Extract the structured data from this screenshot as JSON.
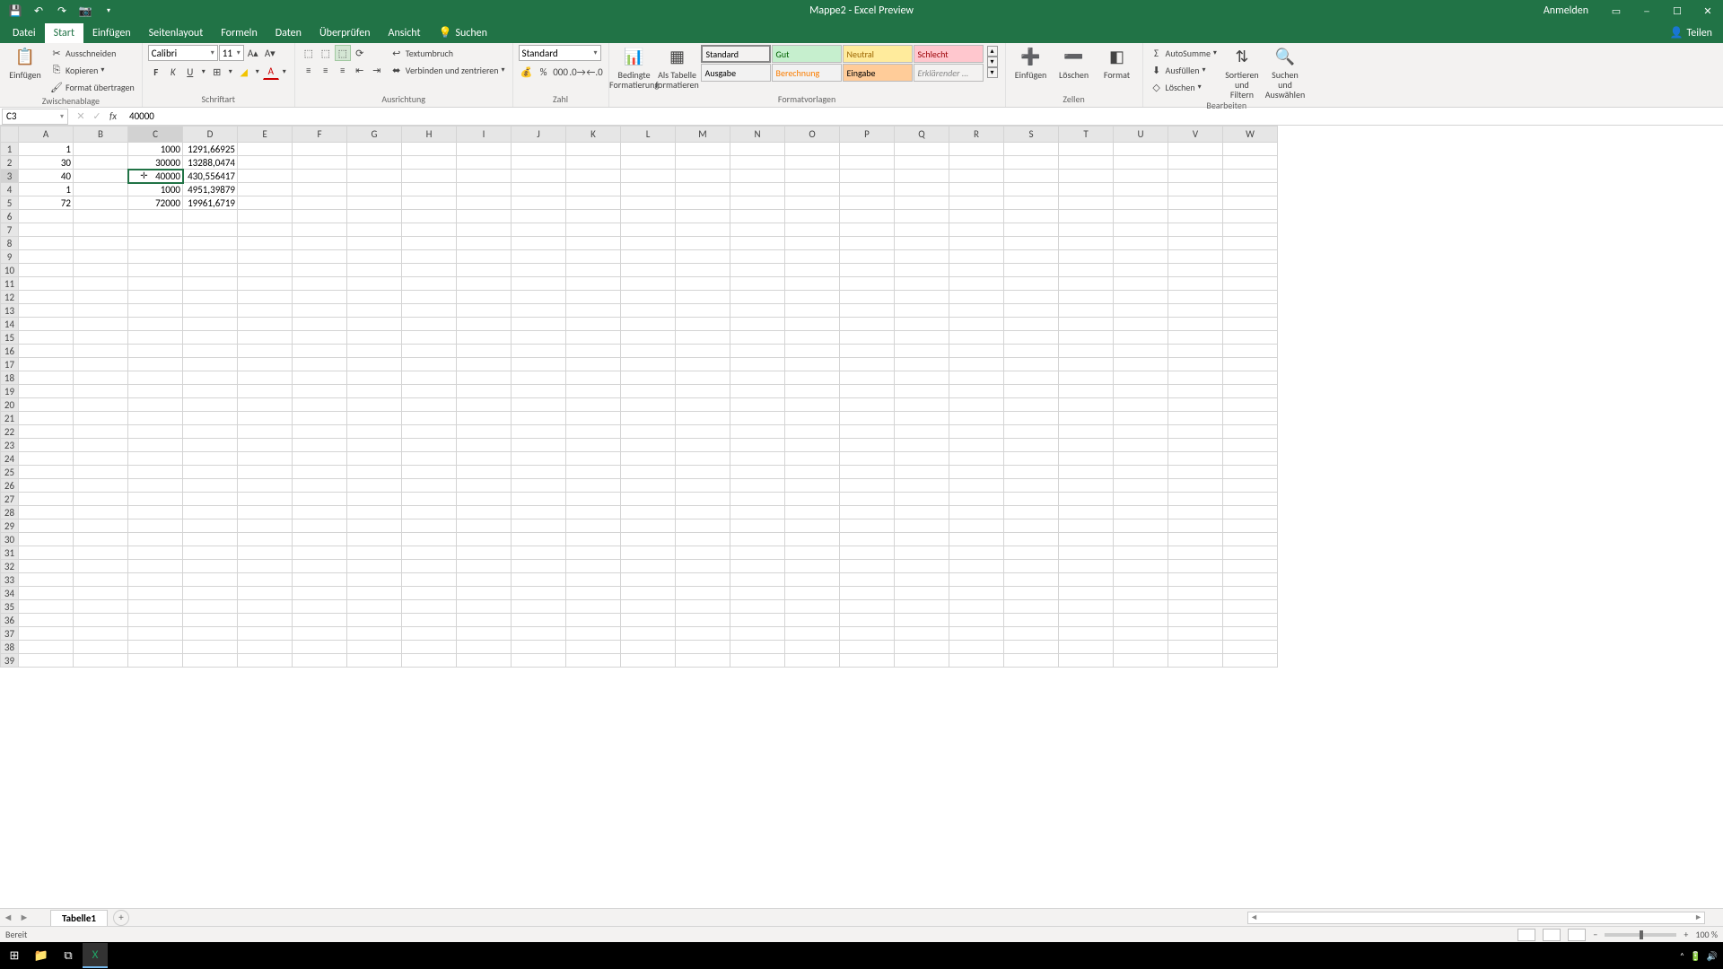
{
  "title": "Mappe2  -  Excel Preview",
  "signin": "Anmelden",
  "tabs": {
    "file": "Datei",
    "home": "Start",
    "insert": "Einfügen",
    "layout": "Seitenlayout",
    "formulas": "Formeln",
    "data": "Daten",
    "review": "Überprüfen",
    "view": "Ansicht",
    "tellme": "Suchen",
    "share": "Teilen"
  },
  "ribbon": {
    "clipboard": {
      "paste": "Einfügen",
      "cut": "Ausschneiden",
      "copy": "Kopieren",
      "painter": "Format übertragen",
      "label": "Zwischenablage"
    },
    "font": {
      "name": "Calibri",
      "size": "11",
      "label": "Schriftart"
    },
    "align": {
      "wrap": "Textumbruch",
      "merge": "Verbinden und zentrieren",
      "label": "Ausrichtung"
    },
    "number": {
      "format": "Standard",
      "label": "Zahl"
    },
    "styles": {
      "cond": "Bedingte Formatierung",
      "table": "Als Tabelle formatieren",
      "s1": "Standard",
      "s2": "Gut",
      "s3": "Neutral",
      "s4": "Schlecht",
      "s5": "Ausgabe",
      "s6": "Berechnung",
      "s7": "Eingabe",
      "s8": "Erklärender ...",
      "label": "Formatvorlagen"
    },
    "cells": {
      "insert": "Einfügen",
      "delete": "Löschen",
      "format": "Format",
      "label": "Zellen"
    },
    "editing": {
      "sum": "AutoSumme",
      "fill": "Ausfüllen",
      "clear": "Löschen",
      "sort": "Sortieren und Filtern",
      "find": "Suchen und Auswählen",
      "label": "Bearbeiten"
    }
  },
  "namebox": "C3",
  "formula": "40000",
  "columns": [
    "A",
    "B",
    "C",
    "D",
    "E",
    "F",
    "G",
    "H",
    "I",
    "J",
    "K",
    "L",
    "M",
    "N",
    "O",
    "P",
    "Q",
    "R",
    "S",
    "T",
    "U",
    "V",
    "W"
  ],
  "sel_col": "C",
  "sel_row": 3,
  "rows": [
    {
      "n": 1,
      "A": "1",
      "C": "1000",
      "D": "1291,66925"
    },
    {
      "n": 2,
      "A": "30",
      "C": "30000",
      "D": "13288,0474"
    },
    {
      "n": 3,
      "A": "40",
      "C": "40000",
      "D": "430,556417"
    },
    {
      "n": 4,
      "A": "1",
      "C": "1000",
      "D": "4951,39879"
    },
    {
      "n": 5,
      "A": "72",
      "C": "72000",
      "D": "19961,6719"
    }
  ],
  "total_rows": 39,
  "sheet_tab": "Tabelle1",
  "status": "Bereit",
  "zoom": "100 %"
}
